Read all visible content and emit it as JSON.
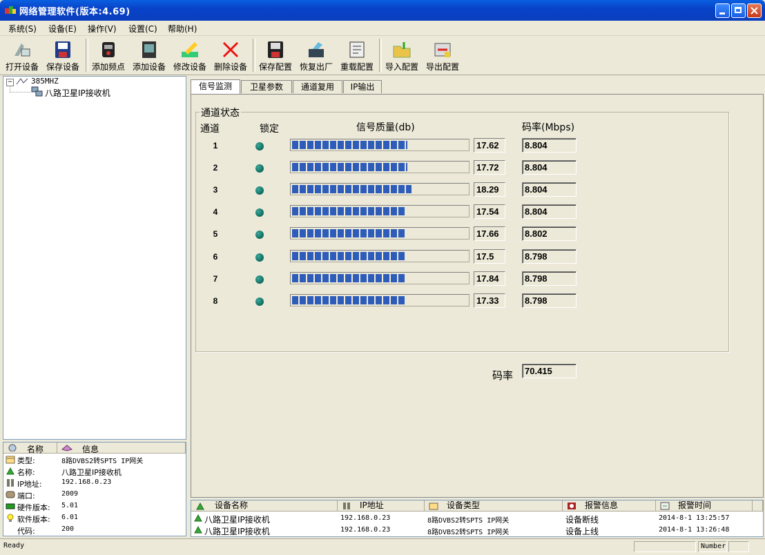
{
  "window": {
    "title": "网络管理软件(版本:4.69)"
  },
  "menu": [
    "系统(S)",
    "设备(E)",
    "操作(V)",
    "设置(C)",
    "帮助(H)"
  ],
  "toolbar": [
    {
      "label": "打开设备",
      "icon": "open-device-icon"
    },
    {
      "label": "保存设备",
      "icon": "save-device-icon"
    },
    {
      "label": "添加频点",
      "icon": "add-frequency-icon"
    },
    {
      "label": "添加设备",
      "icon": "add-device-icon"
    },
    {
      "label": "修改设备",
      "icon": "edit-device-icon"
    },
    {
      "label": "删除设备",
      "icon": "delete-device-icon"
    },
    {
      "label": "保存配置",
      "icon": "save-config-icon"
    },
    {
      "label": "恢复出厂",
      "icon": "factory-reset-icon"
    },
    {
      "label": "重载配置",
      "icon": "reload-config-icon"
    },
    {
      "label": "导入配置",
      "icon": "import-config-icon"
    },
    {
      "label": "导出配置",
      "icon": "export-config-icon"
    }
  ],
  "tree": {
    "root": "385MHZ",
    "child": "八路卫星IP接收机"
  },
  "info": {
    "headers": {
      "name": "名称",
      "info": "信息"
    },
    "rows": [
      {
        "label": "类型:",
        "value": "8路DVBS2转SPTS IP网关"
      },
      {
        "label": "名称:",
        "value": "八路卫星IP接收机"
      },
      {
        "label": "IP地址:",
        "value": "192.168.0.23"
      },
      {
        "label": "端口:",
        "value": "2009"
      },
      {
        "label": "硬件版本:",
        "value": "5.01"
      },
      {
        "label": "软件版本:",
        "value": "6.01"
      },
      {
        "label": "代码:",
        "value": "200"
      }
    ]
  },
  "tabs": [
    "信号监测",
    "卫星参数",
    "通道复用",
    "IP输出"
  ],
  "monitor": {
    "group_title": "通道状态",
    "headers": {
      "channel": "通道",
      "lock": "锁定",
      "quality": "信号质量(db)",
      "bitrate": "码率(Mbps)"
    },
    "channels": [
      {
        "num": "1",
        "quality": "17.62",
        "bitrate": "8.804",
        "level": 0.654
      },
      {
        "num": "2",
        "quality": "17.72",
        "bitrate": "8.804",
        "level": 0.654
      },
      {
        "num": "3",
        "quality": "18.29",
        "bitrate": "8.804",
        "level": 0.677
      },
      {
        "num": "4",
        "quality": "17.54",
        "bitrate": "8.804",
        "level": 0.638
      },
      {
        "num": "5",
        "quality": "17.66",
        "bitrate": "8.802",
        "level": 0.638
      },
      {
        "num": "6",
        "quality": "17.5",
        "bitrate": "8.798",
        "level": 0.638
      },
      {
        "num": "7",
        "quality": "17.84",
        "bitrate": "8.798",
        "level": 0.638
      },
      {
        "num": "8",
        "quality": "17.33",
        "bitrate": "8.798",
        "level": 0.638
      }
    ],
    "total_label": "码率",
    "total_value": "70.415"
  },
  "alarm": {
    "headers": [
      "设备名称",
      "IP地址",
      "设备类型",
      "报警信息",
      "报警时间"
    ],
    "rows": [
      [
        "八路卫星IP接收机",
        "192.168.0.23",
        "8路DVBS2转SPTS IP网关",
        "设备断线",
        "2014-8-1 13:25:57"
      ],
      [
        "八路卫星IP接收机",
        "192.168.0.23",
        "8路DVBS2转SPTS IP网关",
        "设备上线",
        "2014-8-1 13:26:48"
      ]
    ]
  },
  "status": {
    "left": "Ready",
    "number": "Number"
  }
}
